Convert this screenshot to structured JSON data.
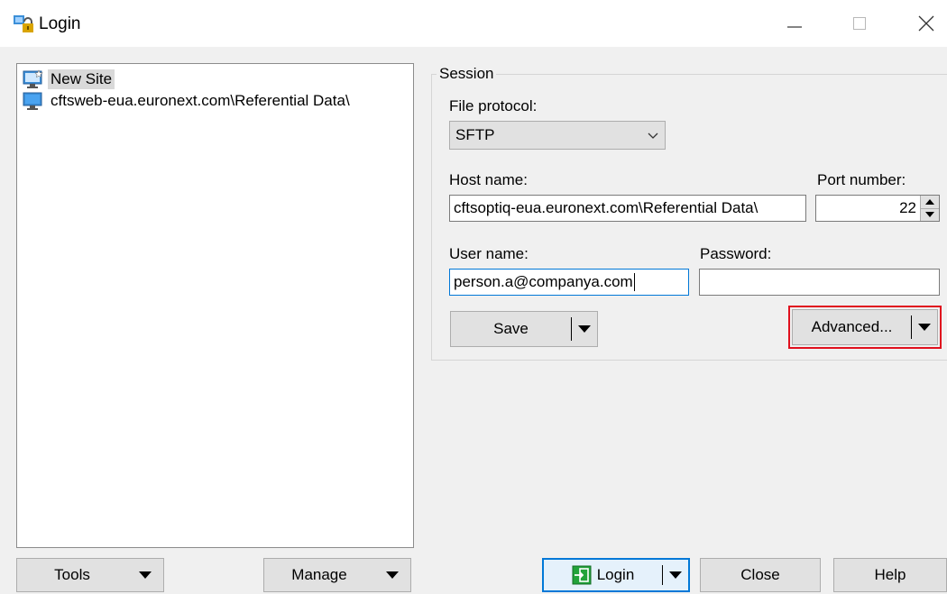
{
  "window": {
    "title": "Login",
    "controls": [
      "minimize",
      "maximize",
      "close"
    ]
  },
  "site_tree": {
    "items": [
      {
        "label": "New Site",
        "icon": "new-site-monitor-icon",
        "selected": true
      },
      {
        "label": "cftsweb-eua.euronext.com\\Referential Data\\",
        "icon": "monitor-icon",
        "selected": false
      }
    ]
  },
  "session": {
    "group_label": "Session",
    "file_protocol": {
      "label": "File protocol:",
      "value": "SFTP"
    },
    "host_name": {
      "label": "Host name:",
      "value": "cftsoptiq-eua.euronext.com\\Referential Data\\"
    },
    "port_number": {
      "label": "Port number:",
      "value": "22"
    },
    "user_name": {
      "label": "User name:",
      "value": "person.a@companya.com"
    },
    "password": {
      "label": "Password:",
      "value": ""
    },
    "save_label": "Save",
    "advanced_label": "Advanced...",
    "highlight_color": "#e0101e"
  },
  "bottom": {
    "tools_label": "Tools",
    "manage_label": "Manage",
    "login_label": "Login",
    "close_label": "Close",
    "help_label": "Help"
  },
  "colors": {
    "accent": "#0078d7",
    "login_icon_green": "#22a33a"
  }
}
